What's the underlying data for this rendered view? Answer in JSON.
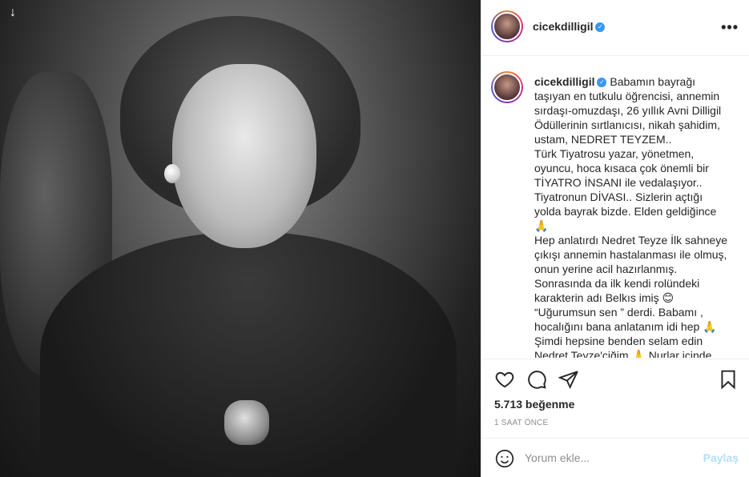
{
  "header": {
    "username": "cicekdilligil",
    "more_label": "•••"
  },
  "photo": {
    "download_icon": "↓"
  },
  "caption": {
    "username": "cicekdilligil",
    "lines": [
      "Babamın bayrağı",
      "taşıyan en tutkulu öğrencisi, annemin",
      "sırdaşı-omuzdaşı, 26 yıllık Avni Dilligil",
      "Ödüllerinin sırtlanıcısı, nikah şahidim,",
      "ustam, NEDRET TEYZEM..",
      "Türk Tiyatrosu yazar, yönetmen,",
      "oyuncu, hoca kısaca çok önemli bir",
      "TİYATRO İNSANI ile vedalaşıyor..",
      "Tiyatronun DİVASI.. Sizlerin açtığı",
      "yolda bayrak bizde. Elden geldiğince",
      "🙏",
      "Hep anlatırdı Nedret Teyze İlk sahneye",
      "çıkışı annemin hastalanması ile olmuş,",
      "onun yerine acil hazırlanmış.",
      "Sonrasında da ilk kendi rolündeki",
      "karakterin adı Belkıs imiş 😊",
      "“Uğurumsun sen ” derdi. Babamı ,",
      "hocalığını bana anlatanım idi hep 🙏",
      "Şimdi hepsine benden selam edin",
      "Nedret Teyze'ciğim 🙏 Nurlar içinde"
    ]
  },
  "actions": {
    "likes": "5.713 beğenme",
    "time": "1 SAAT ÖNCE"
  },
  "comment": {
    "placeholder": "Yorum ekle...",
    "post_label": "Paylaş"
  },
  "colors": {
    "accent": "#3897f0",
    "post_disabled": "#b2dffc",
    "muted": "#8e8e8e",
    "border": "#efefef"
  }
}
